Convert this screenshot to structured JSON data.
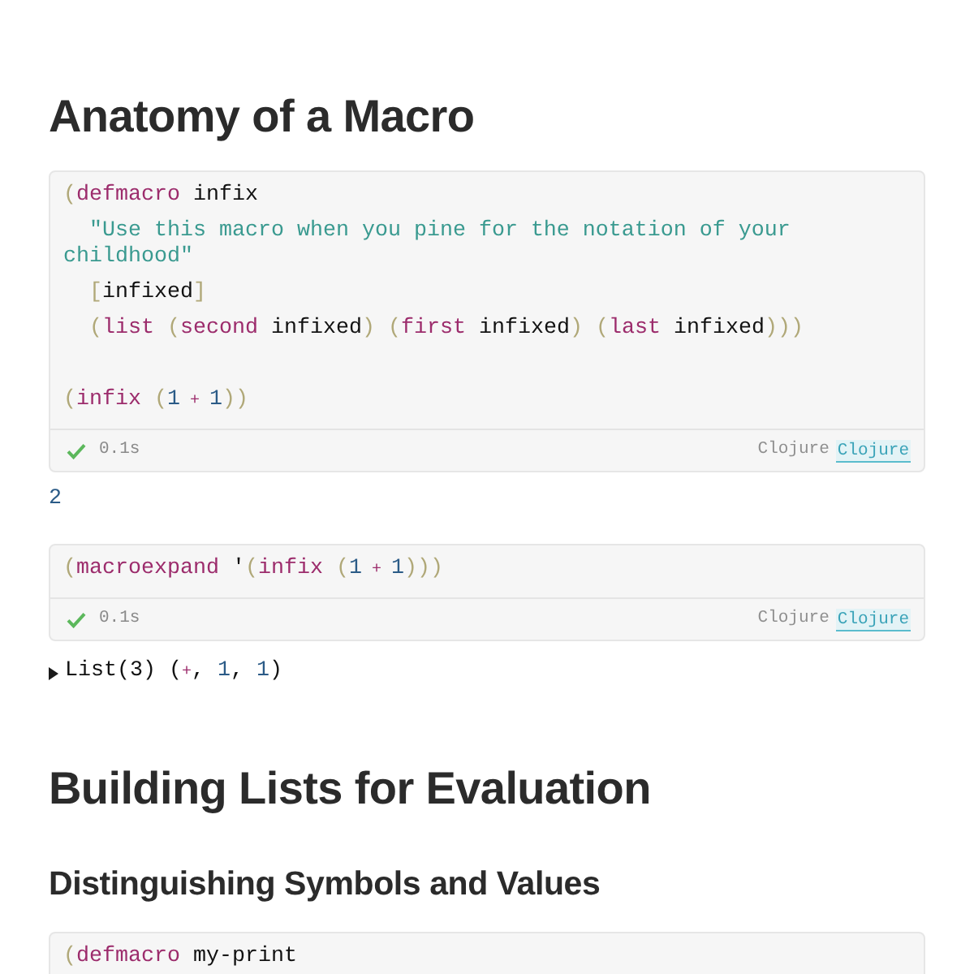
{
  "blocks": [
    {
      "kind": "h1",
      "text": "Anatomy of a Macro"
    },
    {
      "kind": "code_cell",
      "forms": [
        [
          {
            "tokens": [
              {
                "kind": "paren",
                "text": "("
              },
              {
                "kind": "symbol",
                "text": "defmacro"
              },
              {
                "kind": "name",
                "text": " infix"
              }
            ]
          },
          {
            "tokens": [
              {
                "kind": "string",
                "text": "  \"Use this macro when you pine for the notation of your childhood\""
              }
            ]
          },
          {
            "tokens": [
              {
                "kind": "paren",
                "text": "  ["
              },
              {
                "kind": "name",
                "text": "infixed"
              },
              {
                "kind": "paren",
                "text": "]"
              }
            ]
          },
          {
            "tokens": [
              {
                "kind": "paren",
                "text": "  ("
              },
              {
                "kind": "symbol",
                "text": "list"
              },
              {
                "kind": "paren",
                "text": " ("
              },
              {
                "kind": "symbol",
                "text": "second"
              },
              {
                "kind": "name",
                "text": " infixed"
              },
              {
                "kind": "paren",
                "text": ") ("
              },
              {
                "kind": "symbol",
                "text": "first"
              },
              {
                "kind": "name",
                "text": " infixed"
              },
              {
                "kind": "paren",
                "text": ") ("
              },
              {
                "kind": "symbol",
                "text": "last"
              },
              {
                "kind": "name",
                "text": " infixed"
              },
              {
                "kind": "paren",
                "text": ")))"
              }
            ]
          }
        ],
        [
          {
            "tokens": [
              {
                "kind": "paren",
                "text": "("
              },
              {
                "kind": "symbol",
                "text": "infix"
              },
              {
                "kind": "paren",
                "text": " ("
              },
              {
                "kind": "number",
                "text": "1"
              },
              {
                "kind": "operator",
                "text": " + "
              },
              {
                "kind": "number",
                "text": "1"
              },
              {
                "kind": "paren",
                "text": "))"
              }
            ]
          }
        ]
      ],
      "footer": {
        "succeeded": true,
        "time": "0.1s",
        "language": "Clojure",
        "viewer": "Clojure"
      }
    },
    {
      "kind": "value",
      "tokens": [
        {
          "kind": "number",
          "text": "2"
        }
      ]
    },
    {
      "kind": "code_cell",
      "forms": [
        [
          {
            "tokens": [
              {
                "kind": "paren",
                "text": "("
              },
              {
                "kind": "symbol",
                "text": "macroexpand"
              },
              {
                "kind": "name",
                "text": " '"
              },
              {
                "kind": "paren",
                "text": "("
              },
              {
                "kind": "symbol",
                "text": "infix"
              },
              {
                "kind": "paren",
                "text": " ("
              },
              {
                "kind": "number",
                "text": "1"
              },
              {
                "kind": "operator",
                "text": " + "
              },
              {
                "kind": "number",
                "text": "1"
              },
              {
                "kind": "paren",
                "text": ")))"
              }
            ]
          }
        ]
      ],
      "footer": {
        "succeeded": true,
        "time": "0.1s",
        "language": "Clojure",
        "viewer": "Clojure"
      }
    },
    {
      "kind": "collapsible_value",
      "expanded": false,
      "tokens": [
        {
          "kind": "name",
          "text": "List(3) ("
        },
        {
          "kind": "operator",
          "text": "+"
        },
        {
          "kind": "name",
          "text": ", "
        },
        {
          "kind": "number",
          "text": "1"
        },
        {
          "kind": "name",
          "text": ", "
        },
        {
          "kind": "number",
          "text": "1"
        },
        {
          "kind": "name",
          "text": ")"
        }
      ]
    },
    {
      "kind": "h1",
      "text": "Building Lists for Evaluation"
    },
    {
      "kind": "h2",
      "text": "Distinguishing Symbols and Values"
    },
    {
      "kind": "code_cell",
      "forms": [
        [
          {
            "tokens": [
              {
                "kind": "paren",
                "text": "("
              },
              {
                "kind": "symbol",
                "text": "defmacro"
              },
              {
                "kind": "name",
                "text": " my-print"
              }
            ]
          }
        ]
      ]
    }
  ]
}
